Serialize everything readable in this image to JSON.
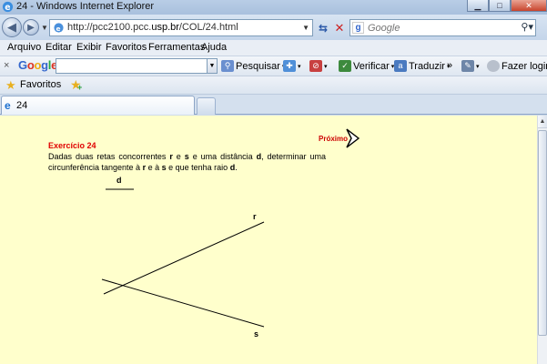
{
  "window": {
    "title": "24 - Windows Internet Explorer"
  },
  "address": {
    "url_prefix": "http://pcc2100.pcc.",
    "url_host": "usp.br",
    "url_suffix": "/COL/24.html"
  },
  "search": {
    "placeholder": "Google"
  },
  "menu": [
    "Arquivo",
    "Editar",
    "Exibir",
    "Favoritos",
    "Ferramentas",
    "Ajuda"
  ],
  "google_toolbar": {
    "close": "×",
    "logo": [
      "G",
      "o",
      "o",
      "g",
      "l",
      "e"
    ],
    "search_label": "Pesquisar",
    "verify_label": "Verificar",
    "translate_label": "Traduzir",
    "more": "»",
    "login_label": "Fazer login"
  },
  "favorites_bar": {
    "label": "Favoritos"
  },
  "tabs": [
    {
      "label": "24"
    }
  ],
  "page": {
    "exercise_title": "Exercício 24",
    "text_part1": "Dadas duas retas concorrentes ",
    "r1": "r",
    "e1": " e ",
    "s1": "s",
    "text_part2": " e uma distância ",
    "d1": "d",
    "text_part3": ", determinar uma circunferência tangente à ",
    "r2": "r",
    "e2": " e à ",
    "s2": "s",
    "text_part4": " e que tenha raio ",
    "d2": "d",
    "text_part5": ".",
    "d_label": "d",
    "next_label": "Próximo",
    "line_r_label": "r",
    "line_s_label": "s"
  },
  "colors": {
    "page_bg": "#ffffcc",
    "title_red": "#e00000",
    "next_red": "#cc0000"
  }
}
